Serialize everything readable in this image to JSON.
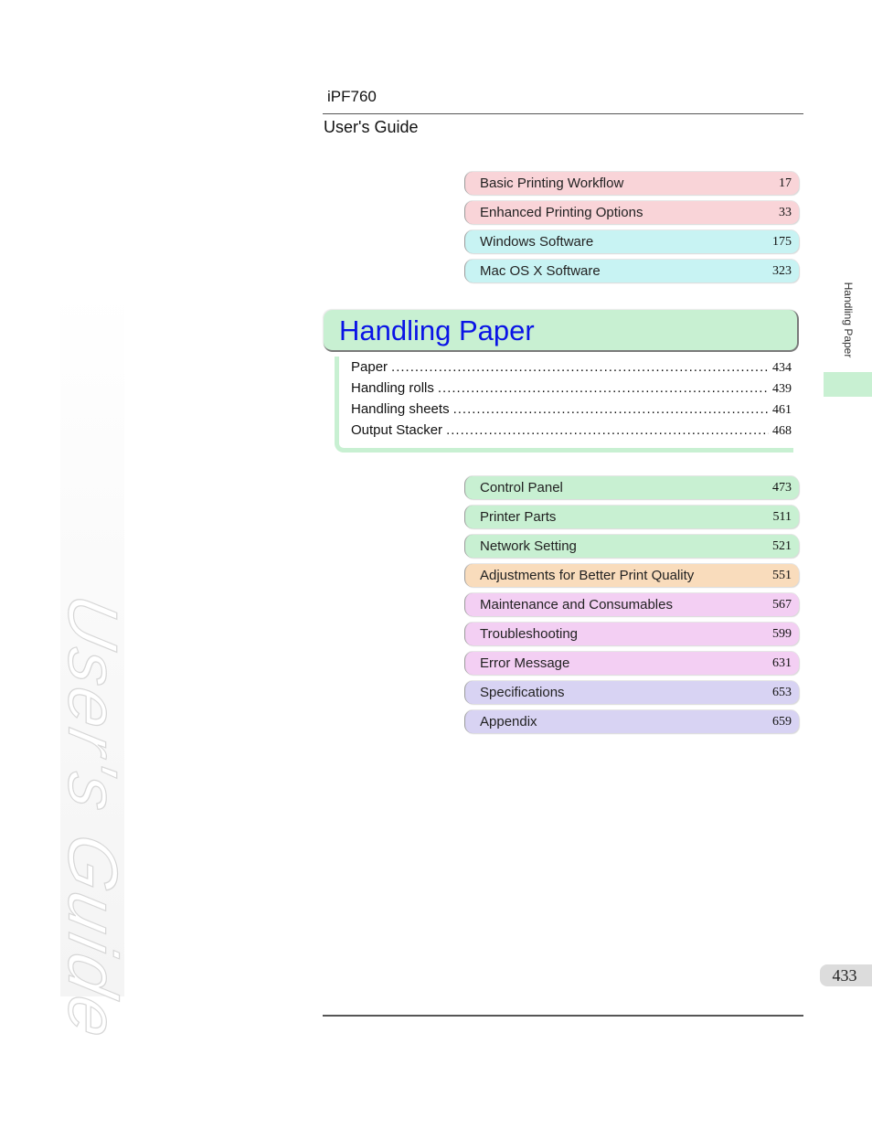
{
  "header": {
    "model": "iPF760",
    "guide_title": "User's Guide"
  },
  "watermark": "User's Guide",
  "chapters_before": [
    {
      "label": "Basic Printing Workflow",
      "page": "17",
      "color": "#f9d4d8"
    },
    {
      "label": "Enhanced Printing Options",
      "page": "33",
      "color": "#f9d4d8"
    },
    {
      "label": "Windows Software",
      "page": "175",
      "color": "#c8f3f3"
    },
    {
      "label": "Mac OS X Software",
      "page": "323",
      "color": "#c8f3f3"
    }
  ],
  "current_section": {
    "title": "Handling Paper",
    "color": "#c8f0d2",
    "title_color": "#0a14e6",
    "items": [
      {
        "label": "Paper",
        "page": "434"
      },
      {
        "label": "Handling rolls",
        "page": "439"
      },
      {
        "label": "Handling sheets",
        "page": "461"
      },
      {
        "label": "Output Stacker",
        "page": "468"
      }
    ]
  },
  "chapters_after": [
    {
      "label": "Control Panel",
      "page": "473",
      "color": "#c8f0d2"
    },
    {
      "label": "Printer Parts",
      "page": "511",
      "color": "#c8f0d2"
    },
    {
      "label": "Network Setting",
      "page": "521",
      "color": "#c8f0d2"
    },
    {
      "label": "Adjustments for Better Print Quality",
      "page": "551",
      "color": "#f9dcbc"
    },
    {
      "label": "Maintenance and Consumables",
      "page": "567",
      "color": "#f3cff3"
    },
    {
      "label": "Troubleshooting",
      "page": "599",
      "color": "#f3cff3"
    },
    {
      "label": "Error Message",
      "page": "631",
      "color": "#f3cff3"
    },
    {
      "label": "Specifications",
      "page": "653",
      "color": "#d8d3f3"
    },
    {
      "label": "Appendix",
      "page": "659",
      "color": "#d8d3f3"
    }
  ],
  "side_tab": {
    "label": "Handling Paper"
  },
  "footer": {
    "page_number": "433"
  }
}
